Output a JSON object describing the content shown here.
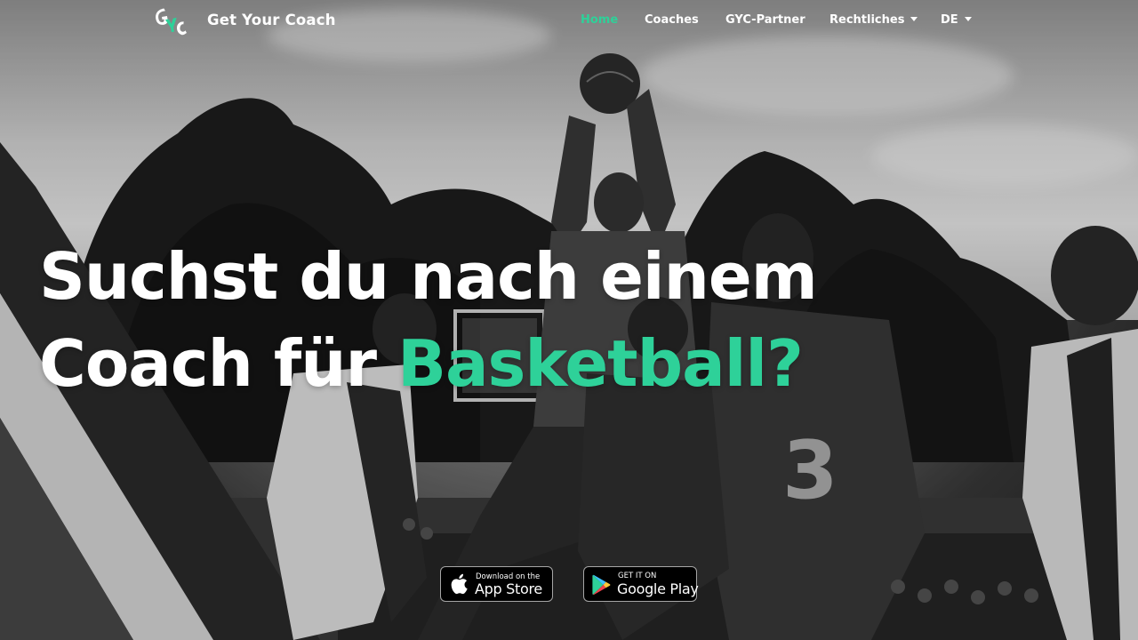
{
  "brand": {
    "name": "Get Your Coach",
    "logo_text": "GYC"
  },
  "nav": {
    "items": [
      {
        "label": "Home",
        "active": true
      },
      {
        "label": "Coaches",
        "active": false
      },
      {
        "label": "GYC-Partner",
        "active": false
      },
      {
        "label": "Rechtliches",
        "active": false,
        "dropdown": true
      },
      {
        "label": "DE",
        "active": false,
        "dropdown": true
      }
    ]
  },
  "hero": {
    "line1": "Suchst du nach einem",
    "line2_prefix": "Coach für ",
    "line2_accent": "Basketball?"
  },
  "badges": {
    "app_store": {
      "small": "Download on the",
      "big": "App Store",
      "icon": "apple-icon"
    },
    "google_play": {
      "small": "GET IT ON",
      "big": "Google Play",
      "icon": "google-play-icon"
    }
  },
  "colors": {
    "accent": "#2ed199",
    "text": "#ffffff",
    "badge_bg": "#000000"
  }
}
